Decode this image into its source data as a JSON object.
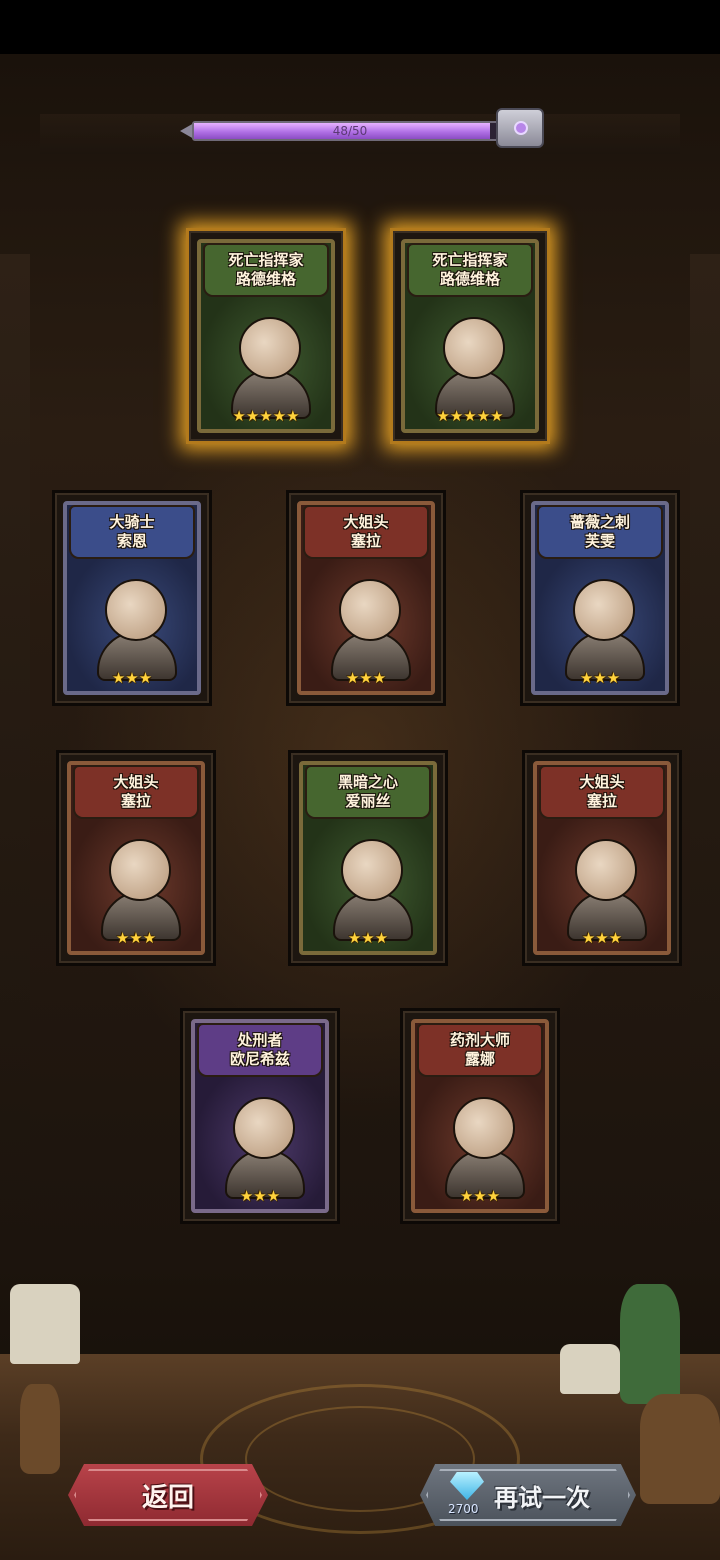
{
  "progress": {
    "text": "48/50",
    "value": 48,
    "max": 50,
    "fill_color": "#b171e6"
  },
  "reward_chest": {
    "icon": "treasure-chest-icon"
  },
  "cards": [
    {
      "id": "ludwig-1",
      "title_line1": "死亡指挥家",
      "title_line2": "路德维格",
      "stars": "★★★★★",
      "star_count": 5,
      "highlighted": true,
      "theme": "green"
    },
    {
      "id": "ludwig-2",
      "title_line1": "死亡指挥家",
      "title_line2": "路德维格",
      "stars": "★★★★★",
      "star_count": 5,
      "highlighted": true,
      "theme": "green"
    },
    {
      "id": "sorn",
      "title_line1": "大骑士",
      "title_line2": "索恩",
      "stars": "★★★",
      "star_count": 3,
      "highlighted": false,
      "theme": "blue"
    },
    {
      "id": "sera-1",
      "title_line1": "大姐头",
      "title_line2": "塞拉",
      "stars": "★★★",
      "star_count": 3,
      "highlighted": false,
      "theme": "red"
    },
    {
      "id": "fuwen",
      "title_line1": "蔷薇之刺",
      "title_line2": "芙雯",
      "stars": "★★★",
      "star_count": 3,
      "highlighted": false,
      "theme": "blue"
    },
    {
      "id": "sera-2",
      "title_line1": "大姐头",
      "title_line2": "塞拉",
      "stars": "★★★",
      "star_count": 3,
      "highlighted": false,
      "theme": "red"
    },
    {
      "id": "alice",
      "title_line1": "黑暗之心",
      "title_line2": "爱丽丝",
      "stars": "★★★",
      "star_count": 3,
      "highlighted": false,
      "theme": "green"
    },
    {
      "id": "sera-3",
      "title_line1": "大姐头",
      "title_line2": "塞拉",
      "stars": "★★★",
      "star_count": 3,
      "highlighted": false,
      "theme": "red"
    },
    {
      "id": "onixi",
      "title_line1": "处刑者",
      "title_line2": "欧尼希兹",
      "stars": "★★★",
      "star_count": 3,
      "highlighted": false,
      "theme": "purple"
    },
    {
      "id": "luna",
      "title_line1": "药剂大师",
      "title_line2": "露娜",
      "stars": "★★★",
      "star_count": 3,
      "highlighted": false,
      "theme": "red"
    }
  ],
  "buttons": {
    "back_label": "返回",
    "retry_label": "再试一次",
    "retry_cost": "2700",
    "retry_cost_icon": "diamond-icon"
  },
  "colors": {
    "highlight_glow": "#ffb428",
    "star": "#ffd23c",
    "theme_green": "#4f6a3a",
    "theme_blue": "#3e4f86",
    "theme_red": "#7a3a30",
    "theme_purple": "#5a3f7a"
  }
}
